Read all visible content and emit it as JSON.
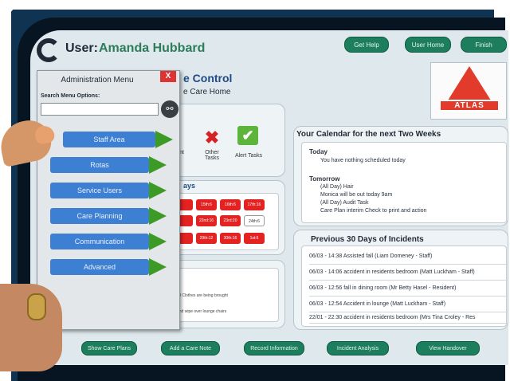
{
  "header": {
    "user_label": "User:",
    "user_name": "Amanda Hubbard",
    "buttons": [
      "Get Help",
      "User Home",
      "Finish"
    ]
  },
  "title": {
    "main": "e Control",
    "sub": "e Care Home"
  },
  "logo": {
    "text": "ATLAS"
  },
  "tasks": {
    "items": [
      {
        "label": "nt",
        "icon": ""
      },
      {
        "label": "Other Tasks",
        "icon": "cross-icon"
      },
      {
        "label": "Alert Tasks",
        "icon": "check-icon"
      }
    ]
  },
  "days": {
    "header": "ays",
    "row1": [
      "",
      "15th:6",
      "16th:6",
      "17th:16"
    ],
    "row2": [
      "",
      "22nd:16",
      "23rd:20",
      "24th:6"
    ],
    "row3": [
      "",
      "29th:12",
      "30th:16",
      "1st:6"
    ]
  },
  "calendar": {
    "title": "Your Calendar for the next Two Weeks",
    "today_label": "Today",
    "today_text": "You have nothing scheduled today",
    "tomorrow_label": "Tomorrow",
    "tomorrow_lines": [
      "(All Day) Hair",
      "Monica will be out today 9am",
      "(All Day) Audit Task",
      "Care Plan interim Check to print and action"
    ]
  },
  "incidents": {
    "title": "Previous 30 Days of Incidents",
    "rows": [
      "06/03 - 14:38 Assisted fall (Liam Domeney - Staff)",
      "06/03 - 14:06 accident in residents bedroom (Matt Luckham - Staff)",
      "06/03 - 12:56 fall in dining room (Mr Betty Hasel - Resident)",
      "06/03 - 12:54 Accident in lounge (Matt Luckham - Staff)",
      "22/01 - 22:30 accident in residents bedroom (Mrs Tina Croley - Res"
    ]
  },
  "notes": {
    "line1": "all Clothes are being brought",
    "line2": "and wipe over lounge chairs"
  },
  "bottom_buttons": [
    "Show Care Plans",
    "Add a Care Note",
    "Record Information",
    "Incident Analysis",
    "View Handover"
  ],
  "admin_menu": {
    "title": "Administration Menu",
    "close": "X",
    "search_label": "Search Menu Options:",
    "search_value": "",
    "items": [
      "Staff Area",
      "Rotas",
      "Service Users",
      "Care Planning",
      "Communication",
      "Advanced"
    ]
  },
  "colors": {
    "accent_green": "#1d7e5e",
    "menu_blue": "#3d7fd3",
    "alert_red": "#e32222"
  }
}
